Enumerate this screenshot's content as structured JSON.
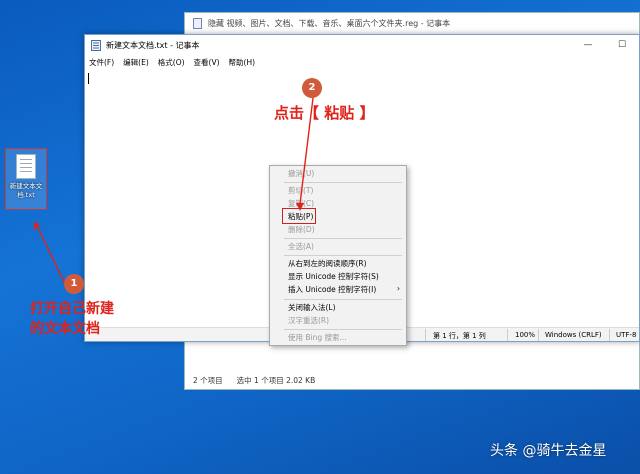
{
  "explorer": {
    "title": "隐藏 视频、图片、文档、下载、音乐、桌面六个文件夹.reg - 记事本",
    "status_items": "2 个项目",
    "status_selected": "选中 1 个项目  2.02 KB"
  },
  "notepad": {
    "title": "新建文本文档.txt - 记事本",
    "controls": {
      "minimize": "—",
      "maximize": "☐"
    },
    "menu": [
      "文件(F)",
      "编辑(E)",
      "格式(O)",
      "查看(V)",
      "帮助(H)"
    ],
    "status": {
      "position": "第 1 行，第 1 列",
      "zoom": "100%",
      "line_ending": "Windows (CRLF)",
      "encoding": "UTF-8"
    }
  },
  "desktop_file": {
    "name": "新建文本文档.txt"
  },
  "context_menu": {
    "items": [
      {
        "label": "撤消(U)",
        "enabled": false
      },
      {
        "label": "剪切(T)",
        "enabled": false
      },
      {
        "label": "复制(C)",
        "enabled": false
      },
      {
        "label": "粘贴(P)",
        "enabled": true
      },
      {
        "label": "删除(D)",
        "enabled": false
      },
      {
        "label": "全选(A)",
        "enabled": false
      },
      {
        "label": "从右到左的阅读顺序(R)",
        "enabled": true
      },
      {
        "label": "显示 Unicode 控制字符(S)",
        "enabled": true
      },
      {
        "label": "插入 Unicode 控制字符(I)",
        "enabled": true
      },
      {
        "label": "关闭输入法(L)",
        "enabled": true
      },
      {
        "label": "汉字重选(R)",
        "enabled": false
      },
      {
        "label": "使用 Bing 搜索...",
        "enabled": false
      }
    ],
    "submenu_arrow": "›"
  },
  "annotations": {
    "step1": {
      "number": "1",
      "text_line1": "打开自己新建",
      "text_line2": "的文本文档"
    },
    "step2": {
      "number": "2",
      "text": "点击【 粘贴 】"
    }
  },
  "watermark": "头条 @骑牛去金星",
  "colors": {
    "annotation_red": "#e0231a",
    "badge": "#d05a3a",
    "desktop_blue": "#1573d6"
  }
}
